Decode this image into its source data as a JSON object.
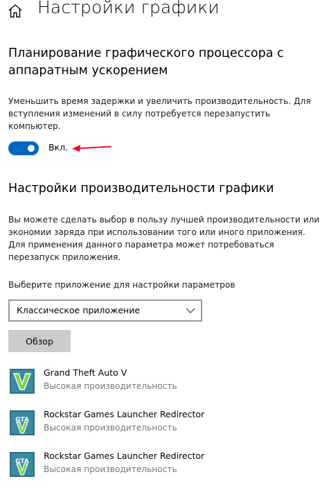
{
  "header": {
    "title": "Настройки графики",
    "home_icon": "home-icon"
  },
  "gpu_scheduling": {
    "title_line1": "Планирование графического процессора с",
    "title_line2": "аппаратным ускорением",
    "desc_line1": "Уменьшить время задержки и увеличить производительность. Для",
    "desc_line2": "вступления изменений в силу потребуется перезапустить",
    "desc_line3": "компьютер.",
    "toggle_state": "on",
    "toggle_label": "Вкл.",
    "accent_color": "#0067c0",
    "annotation_arrow_color": "#e81123"
  },
  "performance": {
    "title": "Настройки производительности графики",
    "desc_line1": "Вы можете сделать выбор в пользу лучшей производительности или",
    "desc_line2": "экономии заряда при использовании того или иного приложения.",
    "desc_line3": "Для применения данного параметра может потребоваться",
    "desc_line4": "перезапуск приложения.",
    "select_label": "Выберите приложение для настройки параметров",
    "select_value": "Классическое приложение",
    "browse_label": "Обзор"
  },
  "apps": [
    {
      "name": "Grand Theft Auto V",
      "preference": "Высокая производительность",
      "icon": "gta-v-icon"
    },
    {
      "name": "Rockstar Games Launcher Redirector",
      "preference": "Высокая производительность",
      "icon": "gta-v-icon"
    },
    {
      "name": "Rockstar Games Launcher Redirector",
      "preference": "Высокая производительность",
      "icon": "gta-v-icon"
    }
  ]
}
